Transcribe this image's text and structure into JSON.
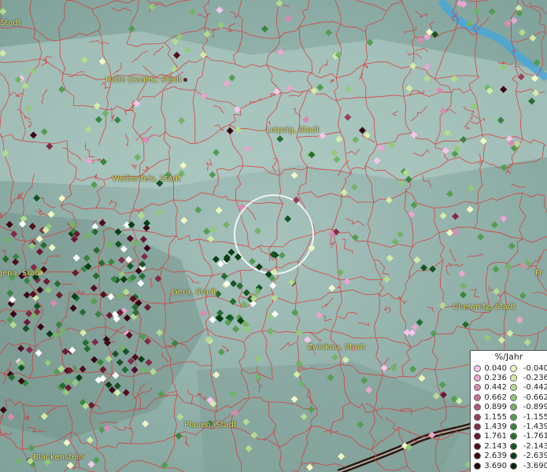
{
  "legend": {
    "title": "%/Jahr",
    "positive": [
      {
        "label": "0.040",
        "color": "#f7c6ec"
      },
      {
        "label": "0.236",
        "color": "#e9a6d0"
      },
      {
        "label": "0.442",
        "color": "#d98ab4"
      },
      {
        "label": "0.662",
        "color": "#c67096"
      },
      {
        "label": "0.899",
        "color": "#b1577a"
      },
      {
        "label": "1.155",
        "color": "#9a3e5e"
      },
      {
        "label": "1.439",
        "color": "#832a46"
      },
      {
        "label": "1.761",
        "color": "#6b1a31"
      },
      {
        "label": "2.143",
        "color": "#530d20"
      },
      {
        "label": "2.639",
        "color": "#3a0614"
      },
      {
        "label": "3.690",
        "color": "#22020a"
      }
    ],
    "negative": [
      {
        "label": "-0.040",
        "color": "#f2f8c4"
      },
      {
        "label": "-0.236",
        "color": "#d4eca8"
      },
      {
        "label": "-0.442",
        "color": "#b4dc8e"
      },
      {
        "label": "-0.662",
        "color": "#93c97a"
      },
      {
        "label": "-0.899",
        "color": "#72b366"
      },
      {
        "label": "-1.155",
        "color": "#549c52"
      },
      {
        "label": "-1.439",
        "color": "#3a8540"
      },
      {
        "label": "-1.761",
        "color": "#256d30"
      },
      {
        "label": "-2.143",
        "color": "#145522"
      },
      {
        "label": "-2.639",
        "color": "#083e15"
      },
      {
        "label": "-3.690",
        "color": "#02260a"
      }
    ]
  },
  "cities": [
    {
      "id": "stadt-top-left",
      "label": "Stadt"
    },
    {
      "id": "halle",
      "label": "Halle (Saale), Stadt"
    },
    {
      "id": "leipzig",
      "label": "Leipzig, Stadt"
    },
    {
      "id": "weissenfels",
      "label": "Weißenfels, Stadt"
    },
    {
      "id": "jena",
      "label": "Jena, Stadt"
    },
    {
      "id": "gera",
      "label": "Gera, Stadt"
    },
    {
      "id": "chemnitz",
      "label": "Chemnitz, Stadt"
    },
    {
      "id": "zwickau",
      "label": "Zwickau, Stadt"
    },
    {
      "id": "plauen",
      "label": "Plauen, Stadt"
    },
    {
      "id": "blankenstein",
      "label": "Blankenstein"
    },
    {
      "id": "fr-right",
      "label": "Fr"
    }
  ]
}
